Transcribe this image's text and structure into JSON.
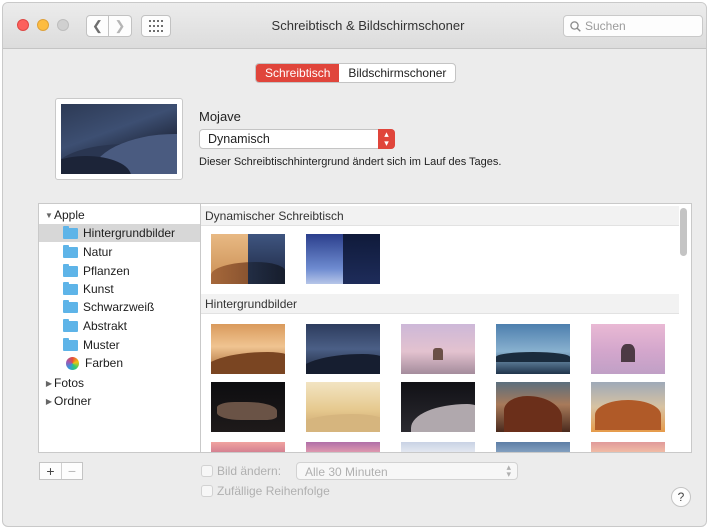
{
  "window": {
    "title": "Schreibtisch & Bildschirmschoner"
  },
  "search": {
    "placeholder": "Suchen"
  },
  "tabs": [
    {
      "label": "Schreibtisch",
      "active": true
    },
    {
      "label": "Bildschirmschoner",
      "active": false
    }
  ],
  "wallpaper": {
    "name": "Mojave",
    "mode": "Dynamisch",
    "description": "Dieser Schreibtischhintergrund ändert sich im Lauf des Tages."
  },
  "sidebar": {
    "groups": [
      {
        "label": "Apple",
        "expanded": true,
        "items": [
          {
            "label": "Hintergrundbilder",
            "icon": "folder-icon",
            "selected": true
          },
          {
            "label": "Natur",
            "icon": "folder-icon"
          },
          {
            "label": "Pflanzen",
            "icon": "folder-icon"
          },
          {
            "label": "Kunst",
            "icon": "folder-icon"
          },
          {
            "label": "Schwarzweiß",
            "icon": "folder-icon"
          },
          {
            "label": "Abstrakt",
            "icon": "folder-icon"
          },
          {
            "label": "Muster",
            "icon": "folder-icon"
          },
          {
            "label": "Farben",
            "icon": "color-wheel-icon"
          }
        ]
      },
      {
        "label": "Fotos",
        "expanded": false
      },
      {
        "label": "Ordner",
        "expanded": false
      }
    ]
  },
  "content": {
    "sections": [
      {
        "title": "Dynamischer Schreibtisch"
      },
      {
        "title": "Hintergrundbilder"
      }
    ]
  },
  "bottom": {
    "add_label": "+",
    "remove_label": "−",
    "change_picture_label": "Bild ändern:",
    "interval": "Alle 30 Minuten",
    "random_label": "Zufällige Reihenfolge",
    "help_label": "?"
  },
  "colors": {
    "accent": "#e0453b",
    "folder": "#5eb4e8",
    "selection": "#d7d7d7"
  }
}
